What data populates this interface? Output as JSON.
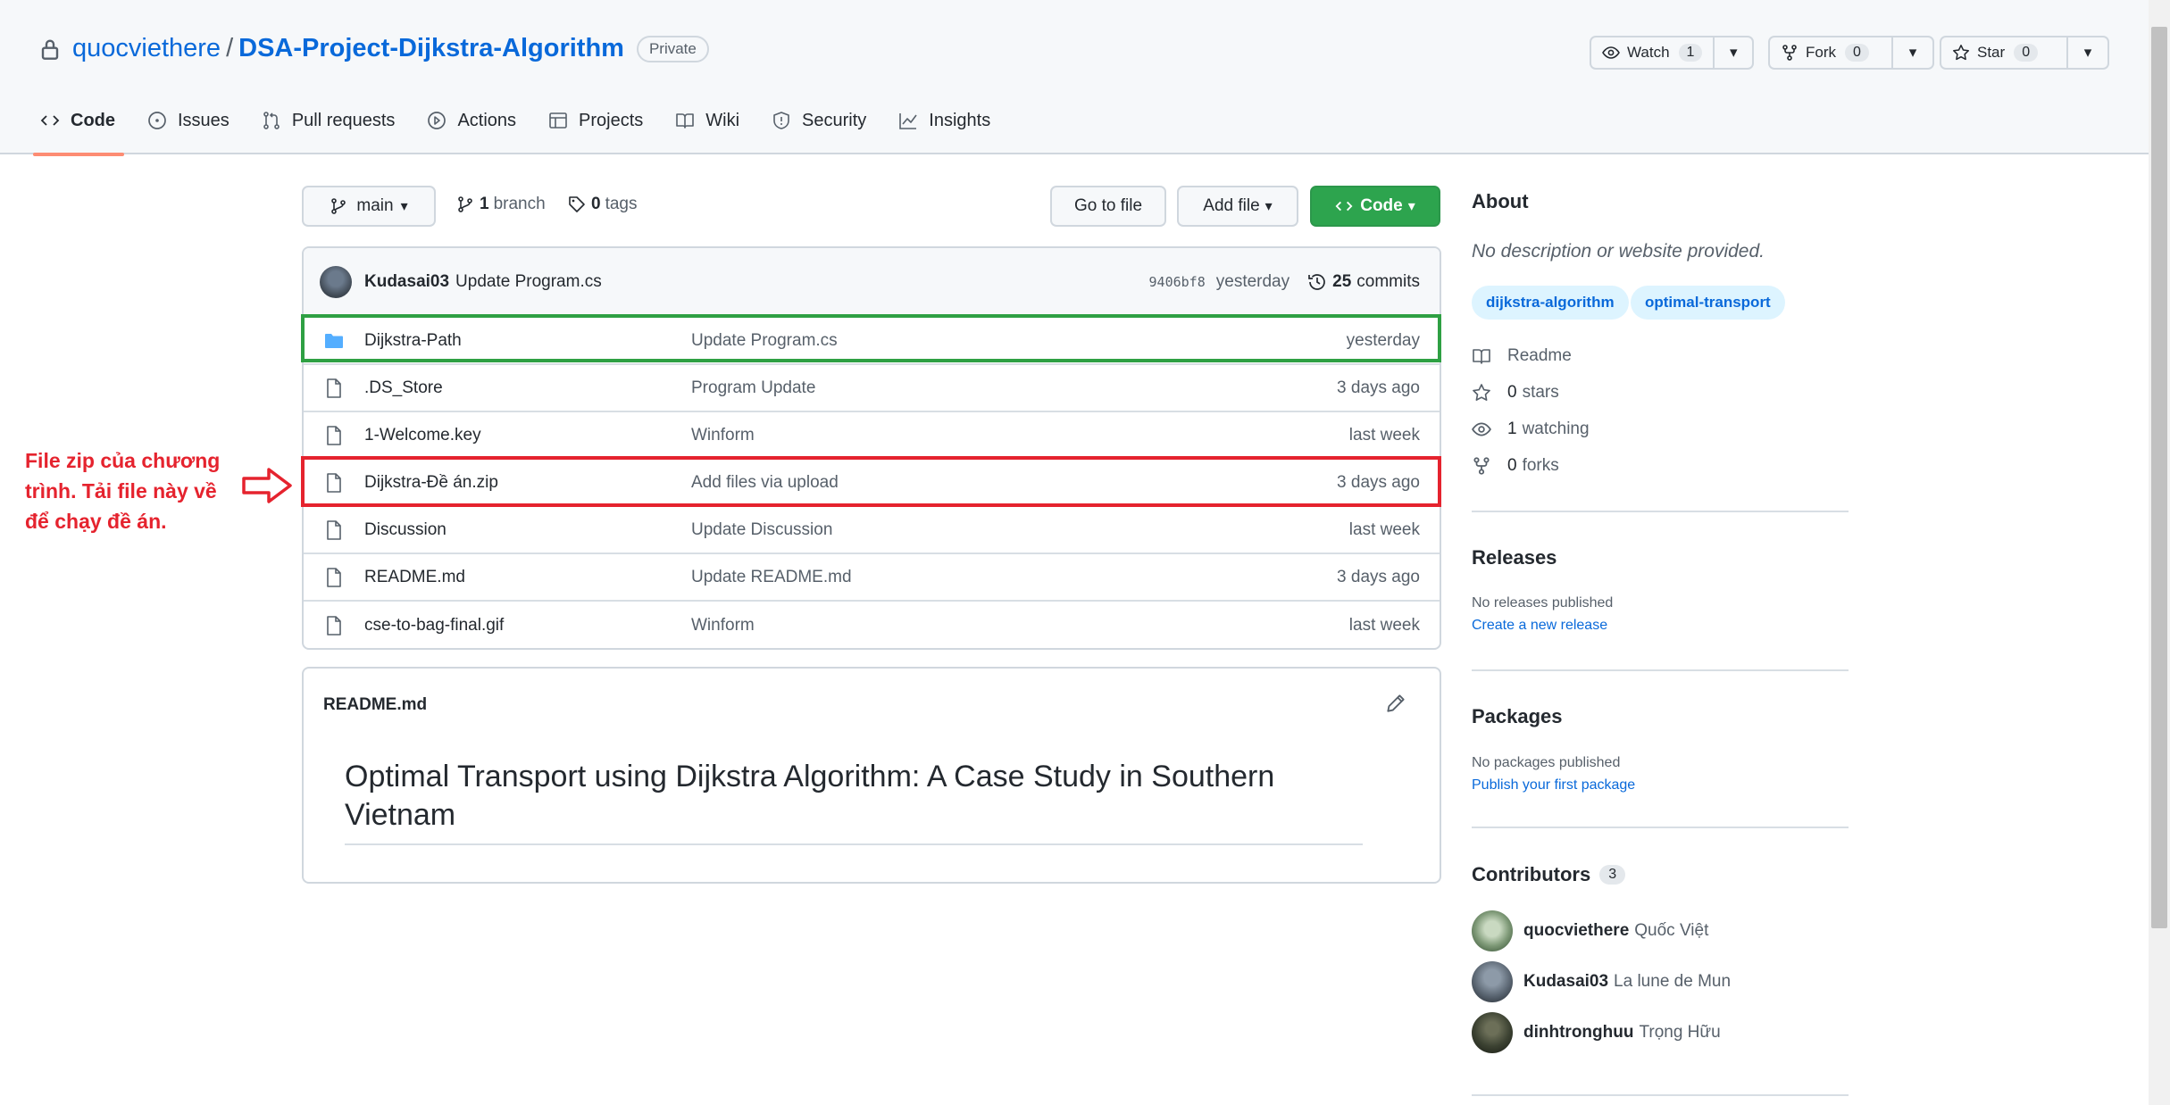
{
  "repo": {
    "owner": "quocviethere",
    "separator": "/",
    "name": "DSA-Project-Dijkstra-Algorithm",
    "visibility": "Private"
  },
  "actions": {
    "watch": {
      "label": "Watch",
      "count": "1"
    },
    "fork": {
      "label": "Fork",
      "count": "0"
    },
    "star": {
      "label": "Star",
      "count": "0"
    }
  },
  "tabs": [
    {
      "label": "Code",
      "icon": "code-icon"
    },
    {
      "label": "Issues",
      "icon": "issue-icon"
    },
    {
      "label": "Pull requests",
      "icon": "pull-request-icon"
    },
    {
      "label": "Actions",
      "icon": "play-icon"
    },
    {
      "label": "Projects",
      "icon": "table-icon"
    },
    {
      "label": "Wiki",
      "icon": "book-icon"
    },
    {
      "label": "Security",
      "icon": "shield-icon"
    },
    {
      "label": "Insights",
      "icon": "graph-icon"
    }
  ],
  "toolbar": {
    "branch": "main",
    "branches_count": "1",
    "branches_label": "branch",
    "tags_count": "0",
    "tags_label": "tags",
    "go_to_file": "Go to file",
    "add_file": "Add file",
    "code": "Code"
  },
  "latest_commit": {
    "author": "Kudasai03",
    "message": "Update Program.cs",
    "sha": "9406bf8",
    "time": "yesterday",
    "commits_count": "25",
    "commits_label": "commits"
  },
  "files": [
    {
      "type": "folder",
      "name": "Dijkstra-Path",
      "message": "Update Program.cs",
      "age": "yesterday"
    },
    {
      "type": "file",
      "name": ".DS_Store",
      "message": "Program Update",
      "age": "3 days ago"
    },
    {
      "type": "file",
      "name": "1-Welcome.key",
      "message": "Winform",
      "age": "last week"
    },
    {
      "type": "file",
      "name": "Dijkstra-Đề án.zip",
      "message": "Add files via upload",
      "age": "3 days ago"
    },
    {
      "type": "file",
      "name": "Discussion",
      "message": "Update Discussion",
      "age": "last week"
    },
    {
      "type": "file",
      "name": "README.md",
      "message": "Update README.md",
      "age": "3 days ago"
    },
    {
      "type": "file",
      "name": "cse-to-bag-final.gif",
      "message": "Winform",
      "age": "last week"
    }
  ],
  "readme": {
    "filename": "README.md",
    "title": "Optimal Transport using Dijkstra Algorithm: A Case Study in Southern Vietnam"
  },
  "annotation": {
    "note": "File zip của chương trình. Tải file này về để chạy đề án.",
    "color": "#e5232e",
    "highlight_green": "#2ea043"
  },
  "about": {
    "heading": "About",
    "description": "No description or website provided.",
    "topics": [
      "dijkstra-algorithm",
      "optimal-transport"
    ],
    "readme_label": "Readme",
    "stars_count": "0",
    "stars_label": "stars",
    "watching_count": "1",
    "watching_label": "watching",
    "forks_count": "0",
    "forks_label": "forks"
  },
  "releases": {
    "heading": "Releases",
    "empty": "No releases published",
    "link": "Create a new release"
  },
  "packages": {
    "heading": "Packages",
    "empty": "No packages published",
    "link": "Publish your first package"
  },
  "contributors": {
    "heading": "Contributors",
    "count": "3",
    "people": [
      {
        "login": "quocviethere",
        "name": "Quốc Việt"
      },
      {
        "login": "Kudasai03",
        "name": "La lune de Mun"
      },
      {
        "login": "dinhtronghuu",
        "name": "Trọng Hữu"
      }
    ]
  },
  "colors": {
    "link": "#0969da",
    "green_button": "#2da44e",
    "active_tab_underline": "#fd8c73"
  }
}
